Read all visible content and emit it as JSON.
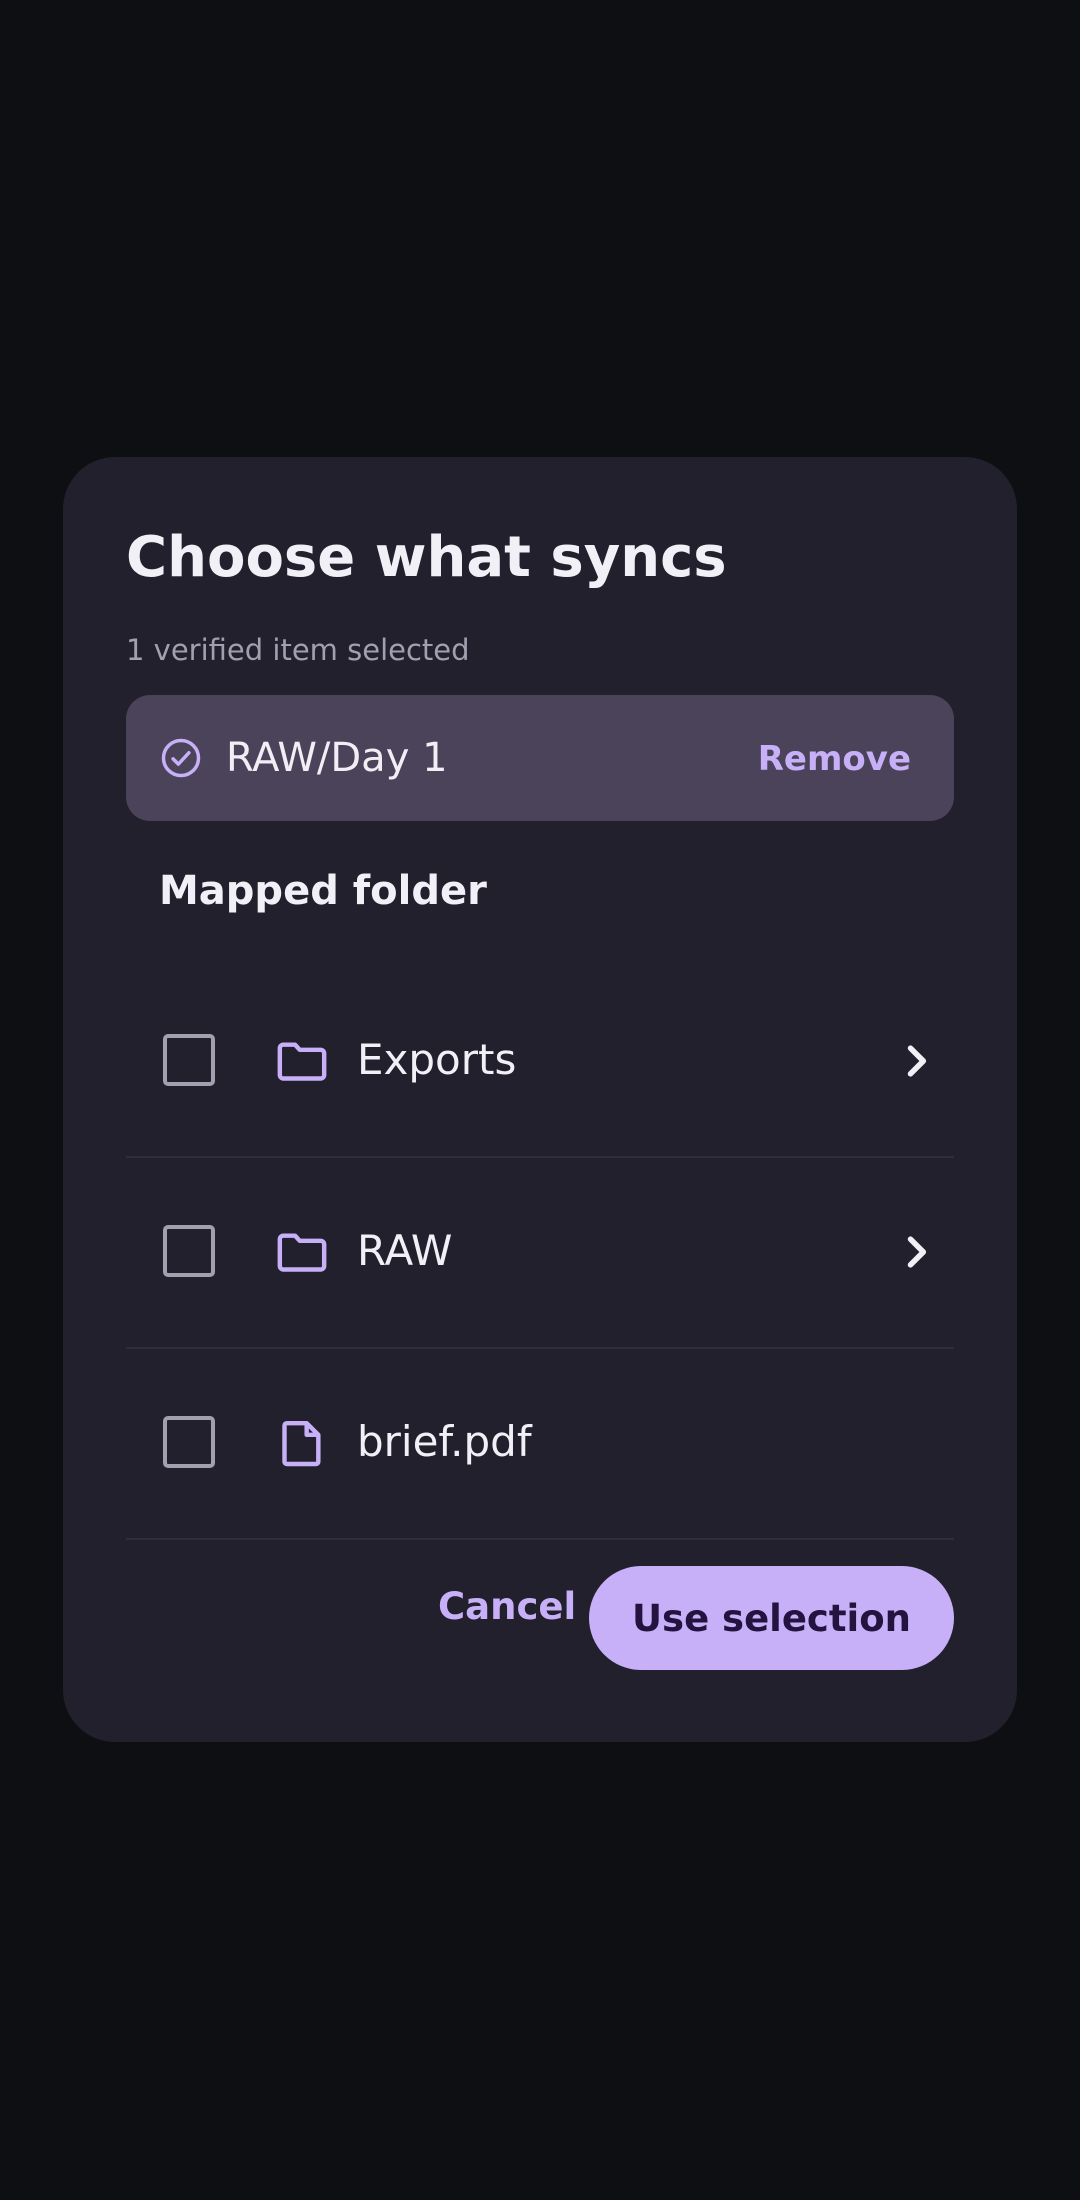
{
  "dialog": {
    "title": "Choose what syncs",
    "subtitle": "1 verified item selected",
    "selected_chip": {
      "icon": "check-circle-icon",
      "label": "RAW/Day 1",
      "remove_label": "Remove"
    },
    "section_title": "Mapped folder",
    "items": [
      {
        "label": "Exports",
        "type": "folder",
        "icon": "folder-icon",
        "checked": false,
        "has_children": true
      },
      {
        "label": "RAW",
        "type": "folder",
        "icon": "folder-icon",
        "checked": false,
        "has_children": true
      },
      {
        "label": "brief.pdf",
        "type": "file",
        "icon": "file-icon",
        "checked": false,
        "has_children": false
      }
    ],
    "footer": {
      "cancel_label": "Cancel",
      "confirm_label": "Use selection"
    }
  },
  "colors": {
    "background": "#0e0f13",
    "dialog": "#22202d",
    "chip": "#4b4359",
    "accent": "#c7b0f8",
    "text": "#f2f0f7",
    "muted": "#a29fb1"
  }
}
